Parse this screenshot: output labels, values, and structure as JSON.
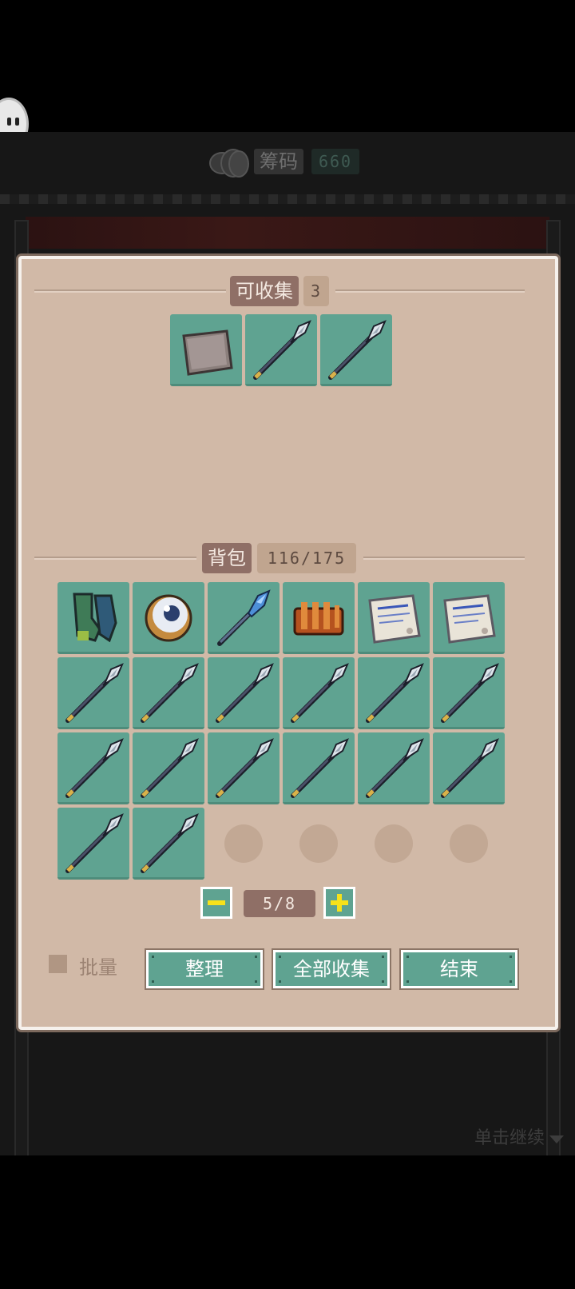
{
  "hud": {
    "chips_label": "筹码",
    "chips_value": "660",
    "tap_continue": "单击继续"
  },
  "collectible": {
    "title": "可收集",
    "count": "3",
    "items": [
      "stone-slab",
      "spear",
      "spear"
    ]
  },
  "backpack": {
    "title": "背包",
    "capacity": "116/175",
    "items": [
      "green-gauntlet",
      "crystal-orb",
      "blue-spear",
      "potion-belt",
      "paper-scroll",
      "paper-scroll",
      "spear",
      "spear",
      "spear",
      "spear",
      "spear",
      "spear",
      "spear",
      "spear",
      "spear",
      "spear",
      "spear",
      "spear",
      "spear",
      "spear",
      "empty",
      "empty",
      "empty",
      "empty"
    ]
  },
  "pager": {
    "indicator": "5/8",
    "minus_icon": "minus-icon",
    "plus_icon": "plus-icon"
  },
  "footer": {
    "batch_label": "批量",
    "sort_button": "整理",
    "collect_all_button": "全部收集",
    "end_button": "结束"
  },
  "colors": {
    "panel": "#d1b9a7",
    "slot": "#5fa391",
    "pill_dark": "#8f6f66",
    "plus_yellow": "#f7e11a"
  }
}
